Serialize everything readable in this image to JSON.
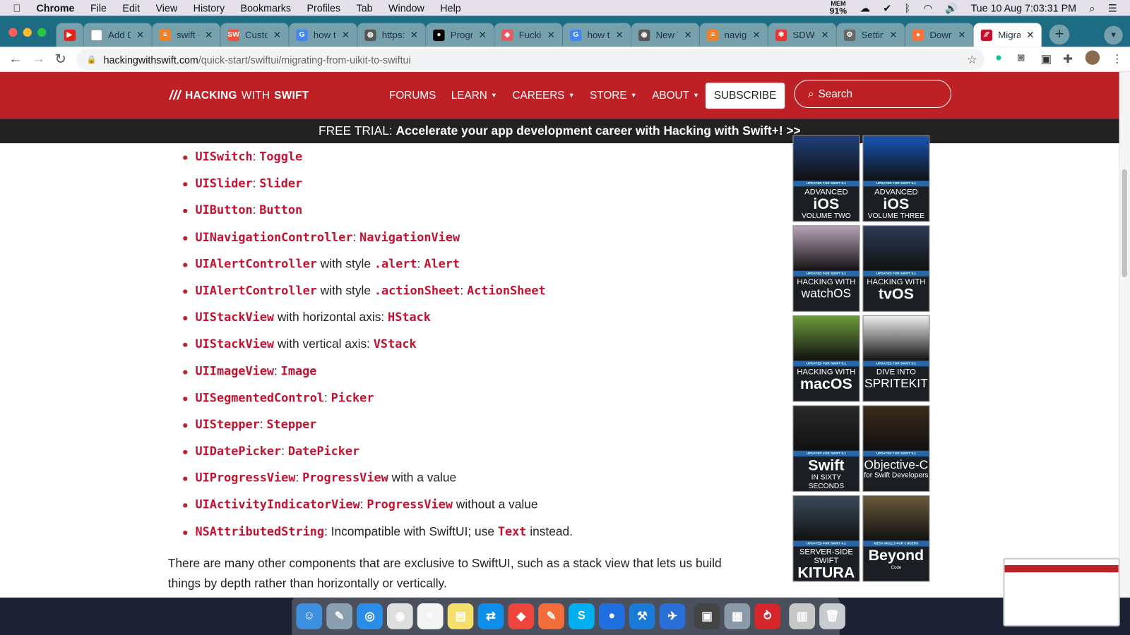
{
  "menubar": {
    "app": "Chrome",
    "items": [
      "File",
      "Edit",
      "View",
      "History",
      "Bookmarks",
      "Profiles",
      "Tab",
      "Window",
      "Help"
    ],
    "mem_label": "MEM",
    "mem_value": "91%",
    "datetime": "Tue 10 Aug  7:03:31 PM"
  },
  "tabs": [
    {
      "label": "",
      "icon": "youtube",
      "color": "#e62117",
      "glyph": "▶"
    },
    {
      "label": "Add D",
      "icon": "doc",
      "color": "#ffffff",
      "glyph": ""
    },
    {
      "label": "swift -",
      "icon": "stackoverflow",
      "color": "#f48024",
      "glyph": "≡"
    },
    {
      "label": "Custo",
      "icon": "swiftwithmajid",
      "color": "#f05138",
      "glyph": "SW"
    },
    {
      "label": "how t",
      "icon": "google",
      "color": "#4285f4",
      "glyph": "G"
    },
    {
      "label": "https:",
      "icon": "globe",
      "color": "#555",
      "glyph": "◍"
    },
    {
      "label": "Progr",
      "icon": "medium",
      "color": "#000",
      "glyph": "●"
    },
    {
      "label": "Fuckin",
      "icon": "fucking",
      "color": "#e8585e",
      "glyph": "◆"
    },
    {
      "label": "how t",
      "icon": "google",
      "color": "#4285f4",
      "glyph": "G"
    },
    {
      "label": "New T",
      "icon": "chrome",
      "color": "#555",
      "glyph": "◉"
    },
    {
      "label": "naviga",
      "icon": "stackoverflow",
      "color": "#f48024",
      "glyph": "≡"
    },
    {
      "label": "SDWe",
      "icon": "sdweb",
      "color": "#e33",
      "glyph": "✱"
    },
    {
      "label": "Settin",
      "icon": "gear",
      "color": "#666",
      "glyph": "⚙"
    },
    {
      "label": "Down",
      "icon": "firefox",
      "color": "#ff7139",
      "glyph": "●"
    },
    {
      "label": "Migra",
      "icon": "hws",
      "color": "#c8102e",
      "glyph": "∕∕∕",
      "active": true
    }
  ],
  "address": {
    "host": "hackingwithswift.com",
    "path": "/quick-start/swiftui/migrating-from-uikit-to-swiftui"
  },
  "site": {
    "logo_bold": "HACKING",
    "logo_thin": "WITH",
    "logo_bold2": "SWIFT",
    "nav": [
      "FORUMS",
      "LEARN",
      "CAREERS",
      "STORE",
      "ABOUT"
    ],
    "subscribe": "SUBSCRIBE",
    "search_placeholder": "Search",
    "banner_prefix": "FREE TRIAL: ",
    "banner_text": "Accelerate your app development career with Hacking with Swift+! >>"
  },
  "list": [
    [
      {
        "c": "UISwitch"
      },
      {
        "t": ": "
      },
      {
        "c": "Toggle"
      }
    ],
    [
      {
        "c": "UISlider"
      },
      {
        "t": ": "
      },
      {
        "c": "Slider"
      }
    ],
    [
      {
        "c": "UIButton"
      },
      {
        "t": ": "
      },
      {
        "c": "Button"
      }
    ],
    [
      {
        "c": "UINavigationController"
      },
      {
        "t": ": "
      },
      {
        "c": "NavigationView"
      }
    ],
    [
      {
        "c": "UIAlertController"
      },
      {
        "t": " with style "
      },
      {
        "c": ".alert"
      },
      {
        "t": ": "
      },
      {
        "c": "Alert"
      }
    ],
    [
      {
        "c": "UIAlertController"
      },
      {
        "t": " with style "
      },
      {
        "c": ".actionSheet"
      },
      {
        "t": ": "
      },
      {
        "c": "ActionSheet"
      }
    ],
    [
      {
        "c": "UIStackView"
      },
      {
        "t": " with horizontal axis: "
      },
      {
        "c": "HStack"
      }
    ],
    [
      {
        "c": "UIStackView"
      },
      {
        "t": " with vertical axis: "
      },
      {
        "c": "VStack"
      }
    ],
    [
      {
        "c": "UIImageView"
      },
      {
        "t": ": "
      },
      {
        "c": "Image"
      }
    ],
    [
      {
        "c": "UISegmentedControl"
      },
      {
        "t": ": "
      },
      {
        "c": "Picker"
      }
    ],
    [
      {
        "c": "UIStepper"
      },
      {
        "t": ": "
      },
      {
        "c": "Stepper"
      }
    ],
    [
      {
        "c": "UIDatePicker"
      },
      {
        "t": ": "
      },
      {
        "c": "DatePicker"
      }
    ],
    [
      {
        "c": "UIProgressView"
      },
      {
        "t": ": "
      },
      {
        "c": "ProgressView"
      },
      {
        "t": " with a value"
      }
    ],
    [
      {
        "c": "UIActivityIndicatorView"
      },
      {
        "t": ": "
      },
      {
        "c": "ProgressView"
      },
      {
        "t": " without a value"
      }
    ],
    [
      {
        "c": "NSAttributedString"
      },
      {
        "t": ": Incompatible with SwiftUI; use "
      },
      {
        "c": "Text"
      },
      {
        "t": " instead."
      }
    ]
  ],
  "paragraph": "There are many other components that are exclusive to SwiftUI, such as a stack view that lets us build things by depth rather than horizontally or vertically.",
  "books": [
    {
      "strip": "UPDATED FOR SWIFT 5.1",
      "small": "ADVANCED",
      "big": "iOS",
      "sub": "VOLUME TWO",
      "art": "#1f3f7a"
    },
    {
      "strip": "UPDATED FOR SWIFT 5.1",
      "small": "ADVANCED",
      "big": "iOS",
      "sub": "VOLUME THREE",
      "art": "#1756b5"
    },
    {
      "strip": "UPDATED FOR SWIFT 5.1",
      "small": "HACKING WITH",
      "big": "watchOS",
      "sub": "",
      "art": "#b9a2b8"
    },
    {
      "strip": "UPDATED FOR SWIFT 5.1",
      "small": "HACKING WITH",
      "big": "tvOS",
      "sub": "",
      "art": "#2b3a55"
    },
    {
      "strip": "UPDATED FOR SWIFT 5.1",
      "small": "HACKING WITH",
      "big": "macOS",
      "sub": "",
      "art": "#6c9a3a"
    },
    {
      "strip": "UPDATED FOR SWIFT 5.1",
      "small": "DIVE INTO",
      "big": "SPRITEKIT",
      "sub": "",
      "art": "#eeeeee"
    },
    {
      "strip": "UPDATED FOR SWIFT 5.1",
      "small": "",
      "big": "Swift",
      "sub": "IN SIXTY SECONDS",
      "art": "#2a2a2a"
    },
    {
      "strip": "UPDATED FOR SWIFT 5.1",
      "small": "",
      "big": "Objective-C",
      "sub": "for Swift Developers",
      "art": "#3a2a1a"
    },
    {
      "strip": "UPDATED FOR SWIFT 4.1",
      "small": "SERVER-SIDE SWIFT",
      "big": "KITURA",
      "sub": "",
      "art": "#3a4a5a"
    },
    {
      "strip": "META-SKILLS FOR CODERS",
      "small": "",
      "big": "Beyond",
      "sub": "Code",
      "art": "#6a5a3a"
    }
  ],
  "dock": [
    {
      "name": "finder",
      "color": "#3d8fe0",
      "glyph": "☺"
    },
    {
      "name": "preview",
      "color": "#8aa0b0",
      "glyph": "✎"
    },
    {
      "name": "safari",
      "color": "#2a8ee8",
      "glyph": "◎"
    },
    {
      "name": "chrome",
      "color": "#dddddd",
      "glyph": "◉"
    },
    {
      "name": "textedit",
      "color": "#f4f4f4",
      "glyph": "≡"
    },
    {
      "name": "stickies",
      "color": "#f3df6a",
      "glyph": "▤"
    },
    {
      "name": "teamviewer",
      "color": "#0e8ee9",
      "glyph": "⇄"
    },
    {
      "name": "anydesk",
      "color": "#ef443b",
      "glyph": "◆"
    },
    {
      "name": "swift-playgrounds",
      "color": "#f26d3a",
      "glyph": "✎"
    },
    {
      "name": "skype",
      "color": "#00aff0",
      "glyph": "S"
    },
    {
      "name": "proxyman",
      "color": "#1f6fe0",
      "glyph": "●"
    },
    {
      "name": "xcode",
      "color": "#1a7ad8",
      "glyph": "⚒"
    },
    {
      "name": "instruments",
      "color": "#2a6fd8",
      "glyph": "✈"
    },
    {
      "name": "simulator",
      "color": "#444",
      "glyph": "▣"
    },
    {
      "name": "image-capture",
      "color": "#8a9aa8",
      "glyph": "▦"
    },
    {
      "name": "parallels",
      "color": "#d6252a",
      "glyph": "⥁"
    },
    {
      "name": "archive",
      "color": "#c8c8c8",
      "glyph": "▥"
    },
    {
      "name": "trash",
      "color": "#c8ccd0",
      "glyph": "🗑"
    }
  ]
}
